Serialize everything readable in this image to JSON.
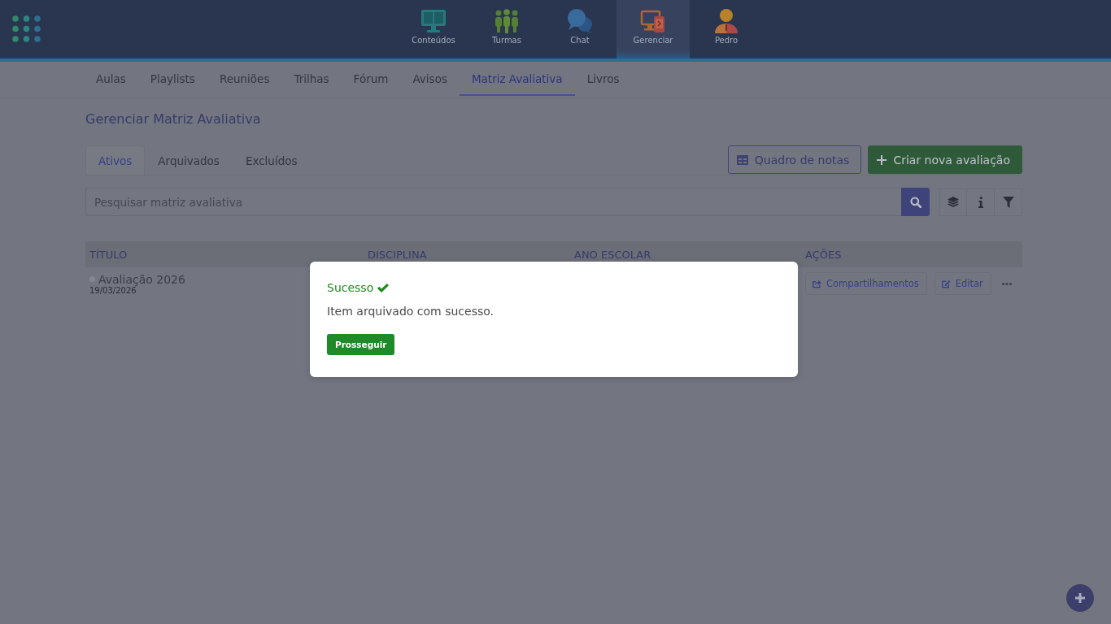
{
  "top_nav": {
    "items": [
      {
        "label": "Conteúdos",
        "kind": "contents",
        "selected": false
      },
      {
        "label": "Turmas",
        "kind": "classes",
        "selected": false
      },
      {
        "label": "Chat",
        "kind": "chat",
        "selected": false
      },
      {
        "label": "Gerenciar",
        "kind": "manage",
        "selected": true
      },
      {
        "label": "Pedro",
        "kind": "profile",
        "selected": false
      }
    ]
  },
  "sub_nav": {
    "tabs": [
      {
        "label": "Aulas",
        "selected": false
      },
      {
        "label": "Playlists",
        "selected": false
      },
      {
        "label": "Reuniões",
        "selected": false
      },
      {
        "label": "Trilhas",
        "selected": false
      },
      {
        "label": "Fórum",
        "selected": false
      },
      {
        "label": "Avisos",
        "selected": false
      },
      {
        "label": "Matriz Avaliativa",
        "selected": true
      },
      {
        "label": "Livros",
        "selected": false
      }
    ]
  },
  "page": {
    "title": "Gerenciar Matriz Avaliativa"
  },
  "status_tabs": [
    {
      "label": "Ativos",
      "selected": true
    },
    {
      "label": "Arquivados",
      "selected": false
    },
    {
      "label": "Excluídos",
      "selected": false
    }
  ],
  "actions": [
    {
      "label": "Quadro de notas",
      "kind": "outline"
    },
    {
      "label": "Criar nova avaliação",
      "kind": "primary"
    }
  ],
  "search": {
    "placeholder": "Pesquisar matriz avaliativa"
  },
  "table": {
    "columns": [
      "TÍTULO",
      "DISCIPLINA",
      "ANO ESCOLAR",
      "AÇÕES"
    ],
    "rows": [
      {
        "title": "Avaliação 2026",
        "date": "19/03/2026",
        "actions": [
          {
            "label": "Compartilhamentos",
            "kind": "share"
          },
          {
            "label": "Editar",
            "kind": "edit"
          }
        ]
      }
    ]
  },
  "dialog": {
    "title": "Sucesso",
    "message": "Item arquivado com sucesso.",
    "button": "Prosseguir"
  }
}
